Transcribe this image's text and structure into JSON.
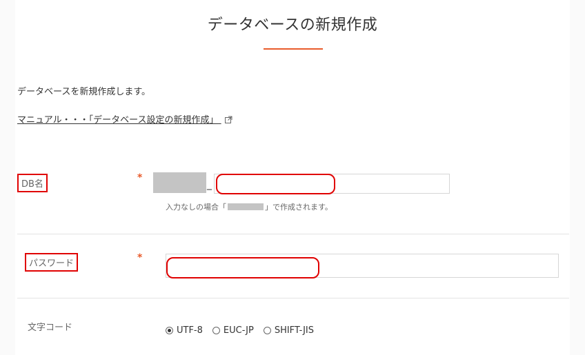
{
  "page": {
    "title": "データベースの新規作成",
    "accent_color": "#e85a2a",
    "annotation_color": "#e00000"
  },
  "intro": {
    "text": "データベースを新規作成します。"
  },
  "manual": {
    "link_text": "マニュアル・・・「データベース設定の新規作成」",
    "icon": "external-link-icon"
  },
  "form": {
    "db_name": {
      "label": "DB名",
      "required_mark": "*",
      "separator": "_",
      "value": "",
      "hint_before": "入力なしの場合「",
      "hint_after": "」で作成されます。"
    },
    "password": {
      "label": "パスワード",
      "required_mark": "*",
      "value": ""
    },
    "charset": {
      "label": "文字コード",
      "options": [
        "UTF-8",
        "EUC-JP",
        "SHIFT-JIS"
      ],
      "selected": "UTF-8"
    }
  }
}
